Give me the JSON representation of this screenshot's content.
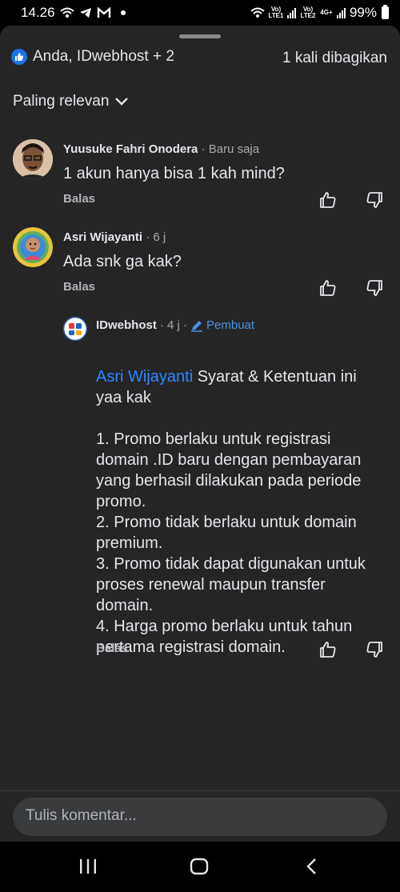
{
  "status_bar": {
    "time": "14.26",
    "sim1_label": "Vo) LTE1",
    "sim2_label": "Vo) LTE2",
    "network": "4G+",
    "battery": "99%"
  },
  "reactions": {
    "summary": "Anda, IDwebhost + 2",
    "shares": "1 kali dibagikan"
  },
  "sort": {
    "label": "Paling relevan"
  },
  "comments": [
    {
      "name": "Yuusuke Fahri Onodera",
      "time": "· Baru saja",
      "text": "1 akun hanya bisa 1 kah mind?",
      "reply_label": "Balas"
    },
    {
      "name": "Asri Wijayanti",
      "time": "· 6 j",
      "text": "Ada snk ga kak?",
      "reply_label": "Balas"
    }
  ],
  "reply": {
    "name": "IDwebhost",
    "time": "· 4 j ·",
    "badge": "Pembuat",
    "mention": "Asri Wijayanti",
    "lines": [
      " Syarat & Ketentuan ini",
      "yaa kak",
      "",
      "1. Promo berlaku untuk registrasi",
      "domain .ID baru dengan pembayaran",
      "yang berhasil dilakukan pada periode",
      "promo.",
      "2. Promo tidak berlaku untuk domain",
      "premium.",
      "3. Promo tidak dapat digunakan untuk",
      "proses renewal maupun transfer",
      "domain.",
      "4. Harga promo berlaku untuk tahun",
      "pertama registrasi domain."
    ],
    "reply_label": "Balas"
  },
  "composer": {
    "placeholder": "Tulis komentar..."
  },
  "colors": {
    "accent": "#1b74e4",
    "mention": "#2d88ff",
    "background": "#252526"
  }
}
